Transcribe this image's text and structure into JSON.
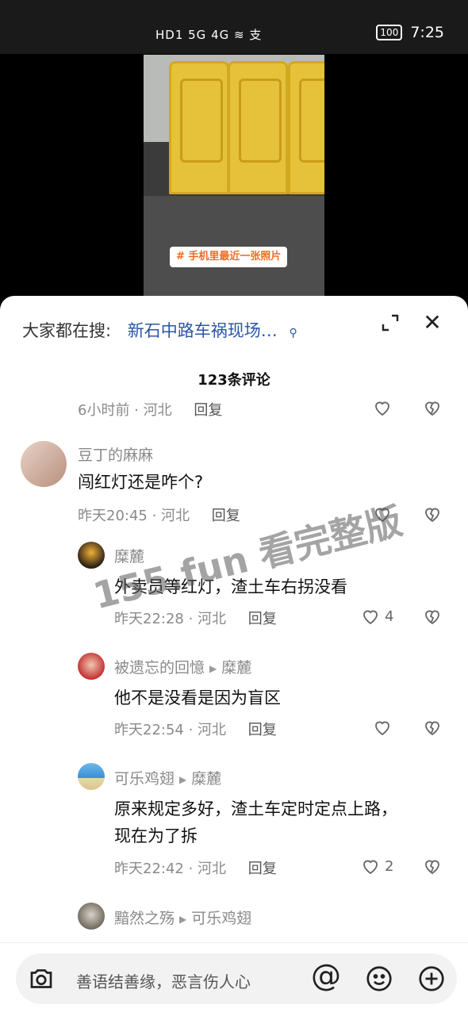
{
  "status_bar": {
    "left_icons": "HD1 5G 4G ≋ 支",
    "battery": "100",
    "time": "7:25"
  },
  "video": {
    "tag": "# 手机里最近一张照片"
  },
  "search": {
    "prefix": "大家都在搜:",
    "query": "新石中路车祸现场…"
  },
  "comments_header": {
    "count": "123条评论"
  },
  "comments": [
    {
      "name": "",
      "text": "",
      "time": "6小时前",
      "location": "河北",
      "reply": "回复",
      "likes": ""
    },
    {
      "name": "豆丁的麻麻",
      "text": "闯红灯还是咋个?",
      "time": "昨天20:45",
      "location": "河北",
      "reply": "回复",
      "likes": ""
    },
    {
      "name": "糜麓",
      "text": "外卖员等红灯，渣土车右拐没看",
      "time": "昨天22:28",
      "location": "河北",
      "reply": "回复",
      "likes": "4"
    },
    {
      "name": "被遗忘的回憶",
      "reply_to": "糜麓",
      "text": "他不是没看是因为盲区",
      "time": "昨天22:54",
      "location": "河北",
      "reply": "回复",
      "likes": ""
    },
    {
      "name": "可乐鸡翅",
      "reply_to": "糜麓",
      "text": "原来规定多好，渣土车定时定点上路，",
      "text2": "现在为了拆",
      "time": "昨天22:42",
      "location": "河北",
      "reply": "回复",
      "likes": "2"
    },
    {
      "name": "黯然之殇",
      "reply_to": "可乐鸡翅"
    }
  ],
  "watermark": "155.fun 看完整版",
  "input": {
    "placeholder": "善语结善缘，恶言伤人心",
    "at": "@"
  },
  "colors": {
    "accent_blue": "#2a56a8",
    "tag_orange": "#f36b22",
    "barrier_yellow": "#e6c23a"
  }
}
